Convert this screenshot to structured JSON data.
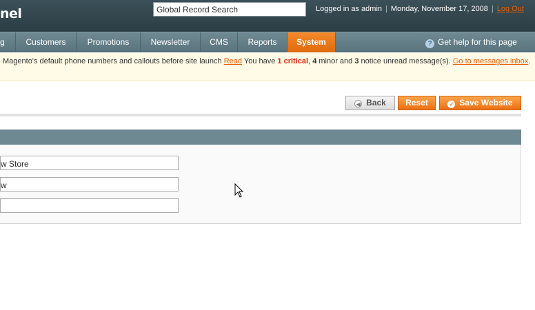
{
  "header": {
    "logo_text": "nel",
    "search": {
      "value": "Global Record Search"
    },
    "logged_in": "Logged in as admin",
    "date": "Monday, November 17, 2008",
    "logout": "Log Out"
  },
  "nav": {
    "items": [
      {
        "label": "g"
      },
      {
        "label": "Customers"
      },
      {
        "label": "Promotions"
      },
      {
        "label": "Newsletter"
      },
      {
        "label": "CMS"
      },
      {
        "label": "Reports"
      },
      {
        "label": "System",
        "active": true
      }
    ],
    "help": "Get help for this page"
  },
  "notice": {
    "message": "Magento's default phone numbers and callouts before site launch",
    "read_link": "Read",
    "you_have": "You have",
    "critical": "1 critical",
    "minor_count": "4",
    "minor_text": "minor and",
    "notice_count": "3",
    "notice_text": "notice unread message(s).",
    "inbox_link": "Go to messages inbox",
    "end": "."
  },
  "buttons": {
    "back": "Back",
    "reset": "Reset",
    "save": "Save Website"
  },
  "form": {
    "fields": [
      {
        "value": "w Store"
      },
      {
        "value": "w"
      },
      {
        "value": ""
      }
    ]
  },
  "colors": {
    "accent": "#eb5e00",
    "header_bg": "#2c3d44",
    "nav_bg": "#6f8a93",
    "critical": "#df280a"
  }
}
